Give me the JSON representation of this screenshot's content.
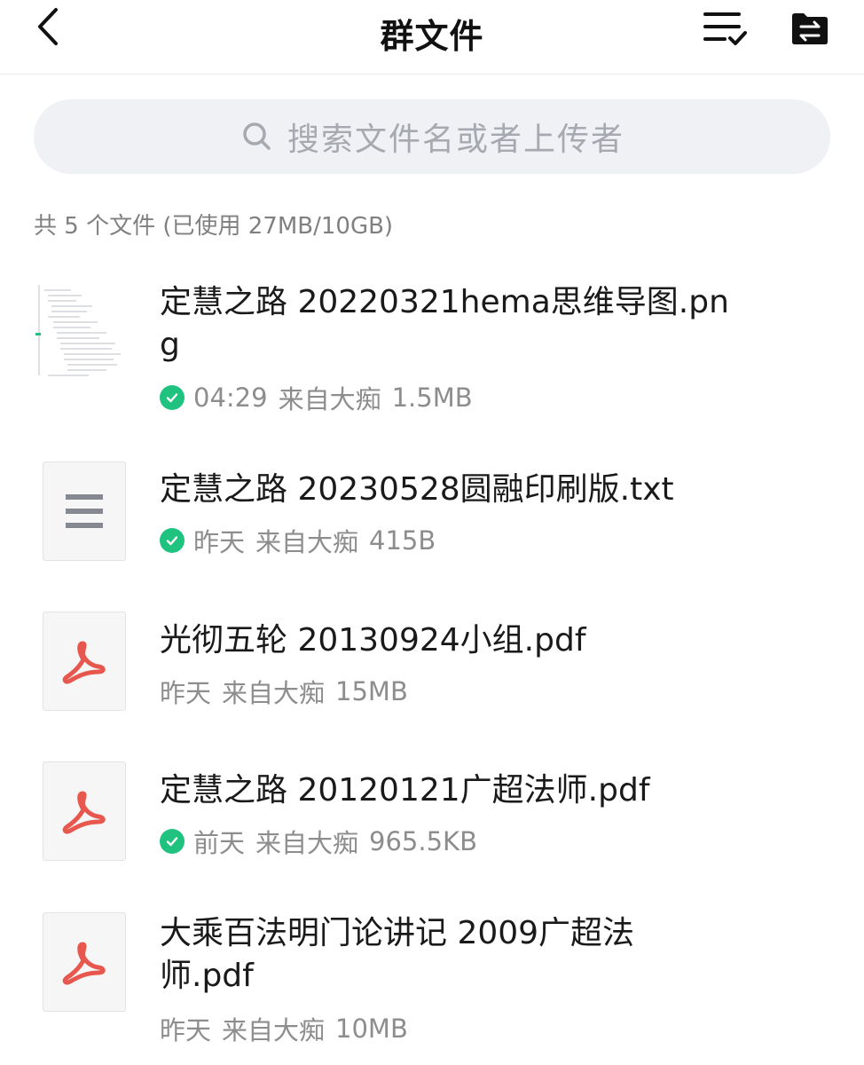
{
  "header": {
    "title": "群文件",
    "back_icon": "chevron-left-icon",
    "multi_select_icon": "list-check-icon",
    "transfer_icon": "folder-transfer-icon"
  },
  "search": {
    "placeholder": "搜索文件名或者上传者",
    "icon": "search-icon"
  },
  "summary": "共 5 个文件 (已使用 27MB/10GB)",
  "colors": {
    "downloaded_check": "#1fc27f",
    "pdf_red": "#e8574d",
    "txt_gray": "#858a92",
    "search_bg": "#f0f1f5"
  },
  "files": [
    {
      "name": "定慧之路 20220321hema思维导图.png",
      "time": "04:29",
      "from": "来自大痴",
      "size": "1.5MB",
      "type": "image",
      "downloaded": true
    },
    {
      "name": "定慧之路 20230528圆融印刷版.txt",
      "time": "昨天",
      "from": "来自大痴",
      "size": "415B",
      "type": "txt",
      "downloaded": true
    },
    {
      "name": "光彻五轮 20130924小组.pdf",
      "time": "昨天",
      "from": "来自大痴",
      "size": "15MB",
      "type": "pdf",
      "downloaded": false
    },
    {
      "name": "定慧之路 20120121广超法师.pdf",
      "time": "前天",
      "from": "来自大痴",
      "size": "965.5KB",
      "type": "pdf",
      "downloaded": true
    },
    {
      "name": "大乘百法明门论讲记 2009广超法师.pdf",
      "time": "昨天",
      "from": "来自大痴",
      "size": "10MB",
      "type": "pdf",
      "downloaded": false
    }
  ]
}
